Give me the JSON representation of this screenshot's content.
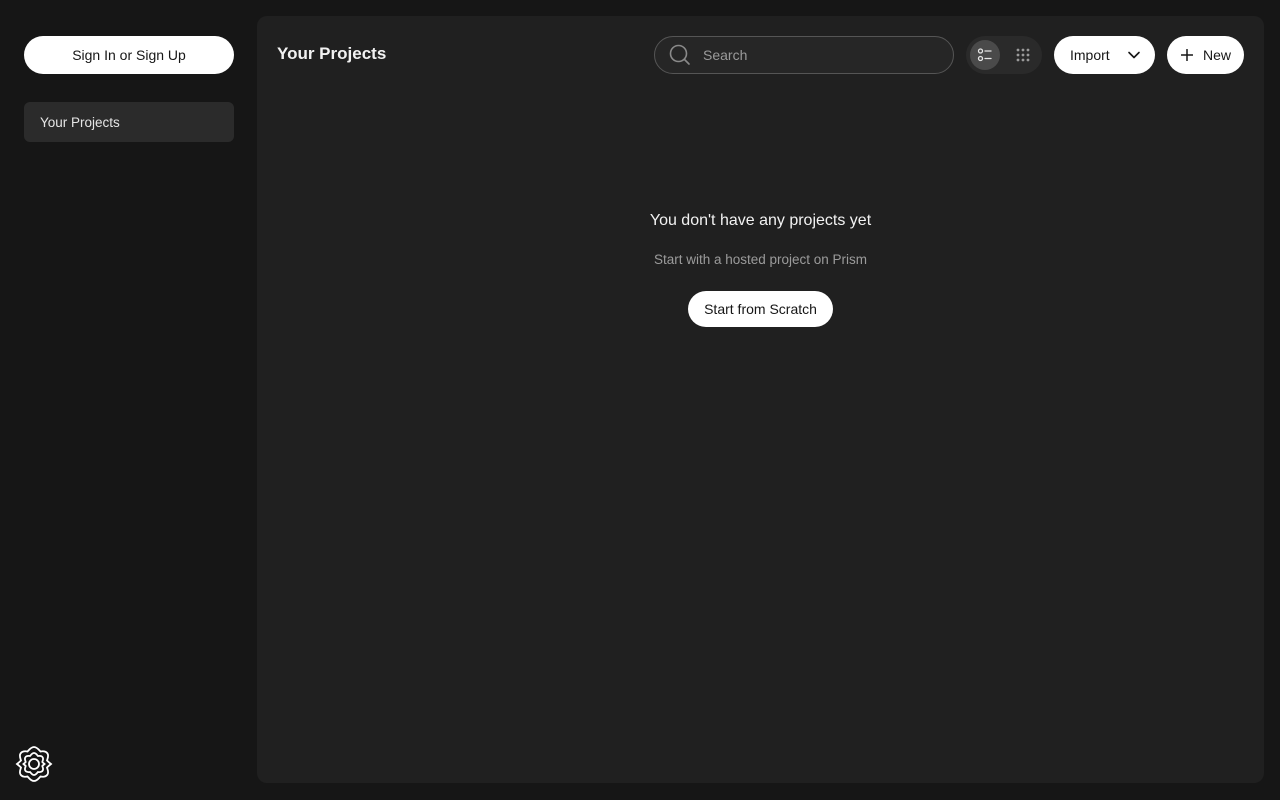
{
  "sidebar": {
    "signin_label": "Sign In or Sign Up",
    "items": [
      {
        "label": "Your Projects",
        "active": true
      }
    ],
    "logo_icon": "flower-logo-icon"
  },
  "header": {
    "title": "Your Projects",
    "search": {
      "placeholder": "Search",
      "value": ""
    },
    "view_modes": [
      {
        "name": "list-view-icon",
        "active": true
      },
      {
        "name": "grid-view-icon",
        "active": false
      }
    ],
    "import_label": "Import",
    "new_label": "New"
  },
  "empty_state": {
    "title": "You don't have any projects yet",
    "subtitle": "Start with a hosted project on Prism",
    "cta_label": "Start from Scratch"
  },
  "colors": {
    "background": "#161616",
    "panel": "#202020",
    "active_nav": "#2b2b2b",
    "button": "#ffffff"
  }
}
